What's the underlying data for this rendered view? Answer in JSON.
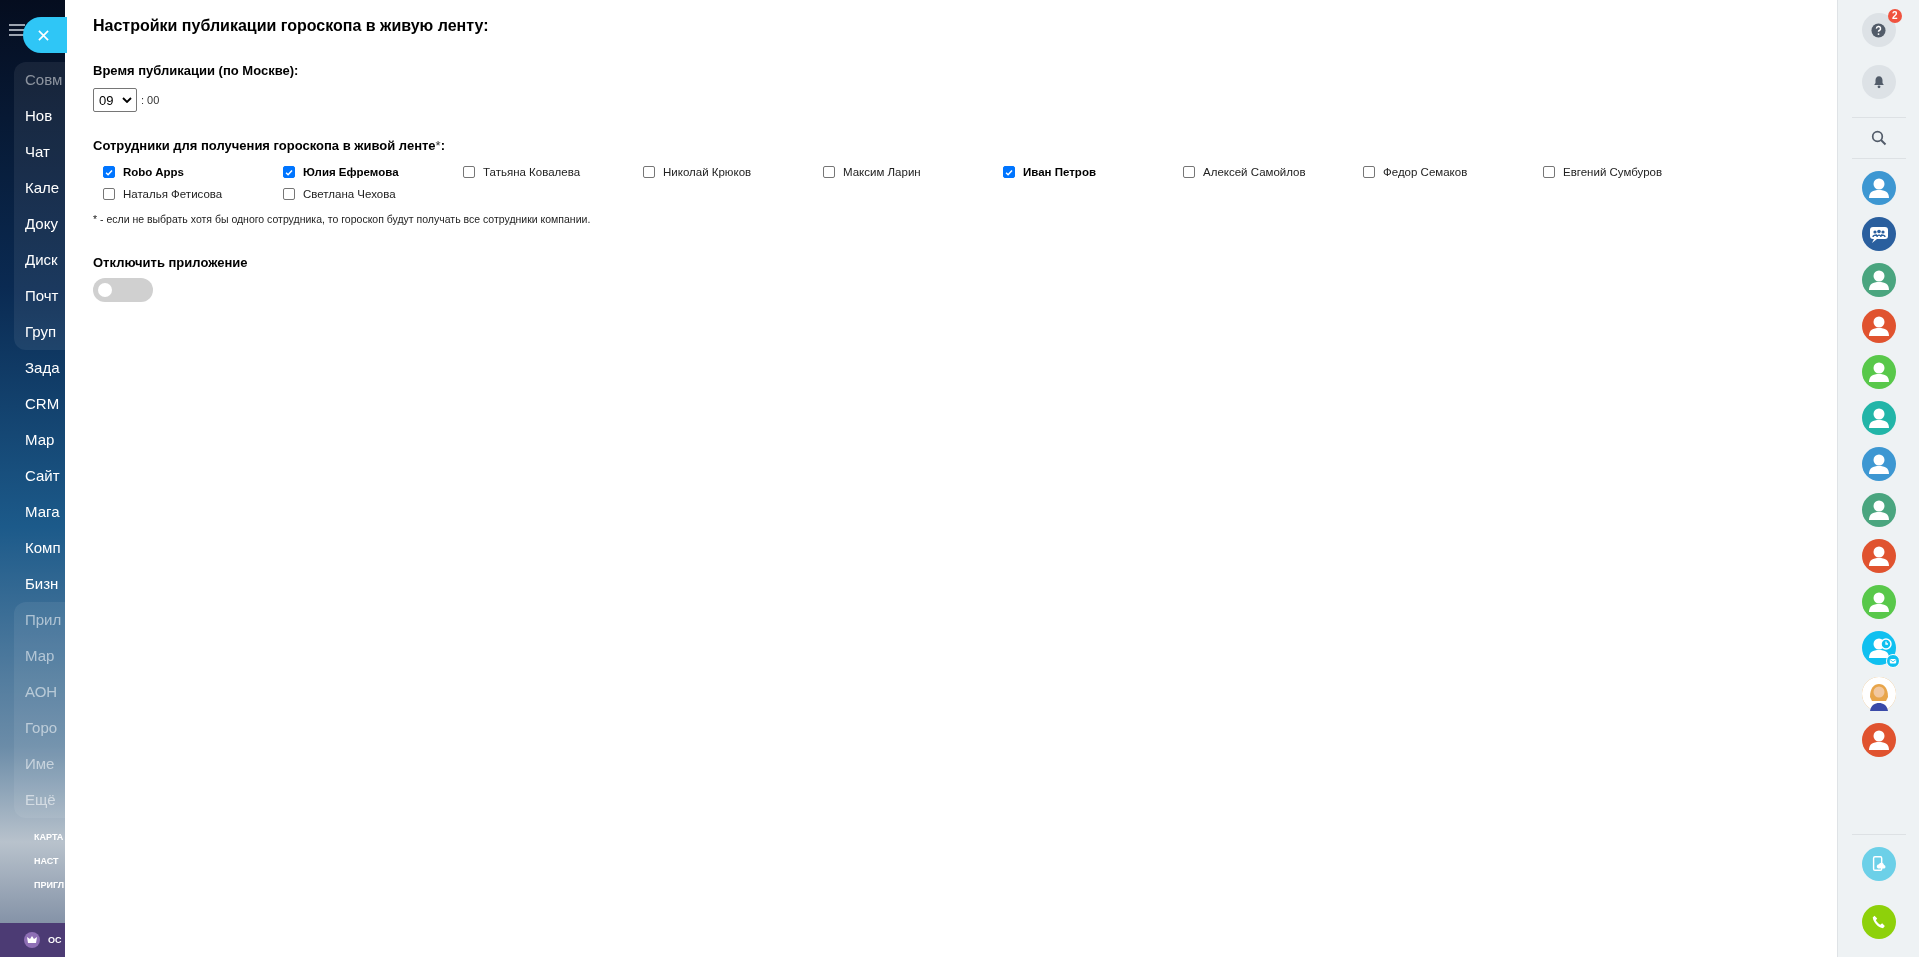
{
  "left_menu": {
    "items": [
      {
        "label": "Совм",
        "kind": "top"
      },
      {
        "label": "Нов",
        "kind": "top"
      },
      {
        "label": "Чат",
        "kind": "top"
      },
      {
        "label": "Кале",
        "kind": "top"
      },
      {
        "label": "Доку",
        "kind": "top"
      },
      {
        "label": "Диск",
        "kind": "top"
      },
      {
        "label": "Почт",
        "kind": "top"
      },
      {
        "label": "Груп",
        "kind": "top"
      },
      {
        "label": "Зада",
        "kind": "plain"
      },
      {
        "label": "CRM",
        "kind": "plain"
      },
      {
        "label": "Мар",
        "kind": "plain"
      },
      {
        "label": "Сайт",
        "kind": "plain"
      },
      {
        "label": "Мага",
        "kind": "plain"
      },
      {
        "label": "Комп",
        "kind": "plain"
      },
      {
        "label": "Бизн",
        "kind": "plain"
      },
      {
        "label": "Прил",
        "kind": "apps"
      },
      {
        "label": "Мар",
        "kind": "apps"
      },
      {
        "label": "АОН",
        "kind": "apps"
      },
      {
        "label": "Горо",
        "kind": "apps"
      },
      {
        "label": "Име",
        "kind": "apps"
      },
      {
        "label": "Ещё",
        "kind": "apps"
      }
    ],
    "links": [
      "КАРТА",
      "НАСТ",
      "ПРИГЛ"
    ],
    "footer": "ОС"
  },
  "panel": {
    "title": "Настройки публикации гороскопа в живую ленту:",
    "time": {
      "label": "Время публикации (по Москве):",
      "hour": "09",
      "minutes": ": 00"
    },
    "employees": {
      "label": "Сотрудники для получения гороскопа в живой ленте",
      "mark": "*",
      "colon": ":",
      "items": [
        {
          "name": "Robo Apps",
          "checked": true
        },
        {
          "name": "Юлия Ефремова",
          "checked": true
        },
        {
          "name": "Татьяна Ковалева",
          "checked": false
        },
        {
          "name": "Николай Крюков",
          "checked": false
        },
        {
          "name": "Максим Ларин",
          "checked": false
        },
        {
          "name": "Иван Петров",
          "checked": true
        },
        {
          "name": "Алексей Самойлов",
          "checked": false
        },
        {
          "name": "Федор Семаков",
          "checked": false
        },
        {
          "name": "Евгений Сумбуров",
          "checked": false
        },
        {
          "name": "Наталья Фетисова",
          "checked": false
        },
        {
          "name": "Светлана Чехова",
          "checked": false
        }
      ],
      "note": "* - если не выбрать хотя бы одного сотрудника, то гороскоп будут получать все сотрудники компании."
    },
    "disable": {
      "label": "Отключить приложение",
      "on": false
    }
  },
  "right_rail": {
    "help_badge": "2",
    "avatars": [
      {
        "kind": "user",
        "color": "#3d97d2"
      },
      {
        "kind": "group",
        "color": "#2a5f9e"
      },
      {
        "kind": "user",
        "color": "#4aa57f"
      },
      {
        "kind": "user",
        "color": "#e0532f"
      },
      {
        "kind": "user",
        "color": "#58c84a"
      },
      {
        "kind": "user",
        "color": "#22b5a8"
      },
      {
        "kind": "user",
        "color": "#3d97d2"
      },
      {
        "kind": "user",
        "color": "#4aa57f"
      },
      {
        "kind": "user",
        "color": "#e0532f"
      },
      {
        "kind": "user",
        "color": "#58c84a"
      },
      {
        "kind": "clock",
        "color": "#10c0f0"
      },
      {
        "kind": "photo",
        "color": "#e8a54a"
      },
      {
        "kind": "user",
        "color": "#e0532f"
      }
    ]
  }
}
